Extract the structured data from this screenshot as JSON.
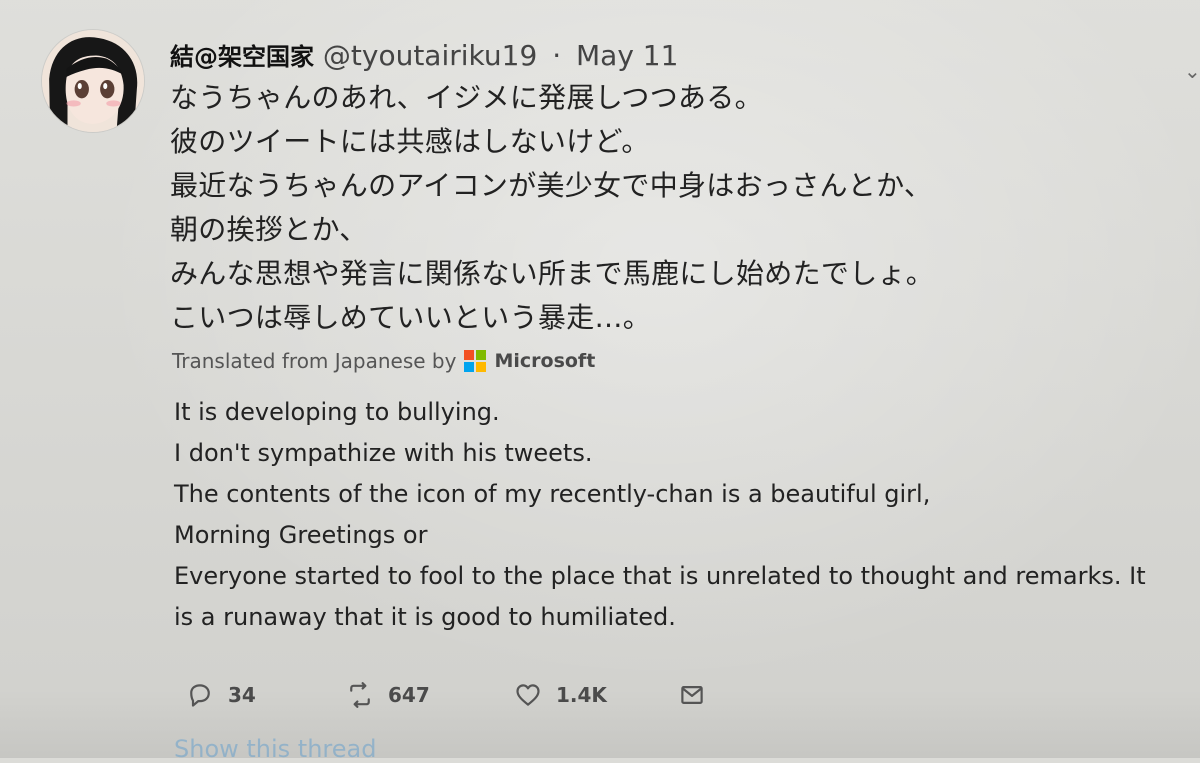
{
  "tweet": {
    "display_name": "結@架空国家",
    "handle": "@tyoutairiku19",
    "separator": "·",
    "date": "May 11",
    "original_lines": [
      "なうちゃんのあれ、イジメに発展しつつある。",
      "彼のツイートには共感はしないけど。",
      "最近なうちゃんのアイコンが美少女で中身はおっさんとか、",
      "朝の挨拶とか、",
      "みんな思想や発言に関係ない所まで馬鹿にし始めたでしょ。",
      "こいつは辱しめていいという暴走…。"
    ],
    "translation": {
      "label": "Translated from Japanese by",
      "provider": "Microsoft",
      "lines": [
        "It is developing to bullying.",
        "I don't sympathize with his tweets.",
        "The contents of the icon of my recently-chan is a beautiful girl,",
        "Morning Greetings or",
        "Everyone started to fool to the place that is unrelated to thought and remarks. It",
        "is a runaway that it is good to humiliated."
      ]
    },
    "actions": {
      "reply_count": "34",
      "retweet_count": "647",
      "like_count": "1.4K"
    },
    "show_thread": "Show this thread"
  },
  "icons": {
    "avatar": "anime-avatar",
    "caret": "chevron-down-icon",
    "reply": "reply-icon",
    "retweet": "retweet-icon",
    "like": "heart-icon",
    "message": "message-icon",
    "microsoft": "microsoft-logo"
  },
  "colors": {
    "background": "#dcdcd8",
    "text": "#1f1f22",
    "muted": "#555555",
    "link": "#58a0d8"
  }
}
